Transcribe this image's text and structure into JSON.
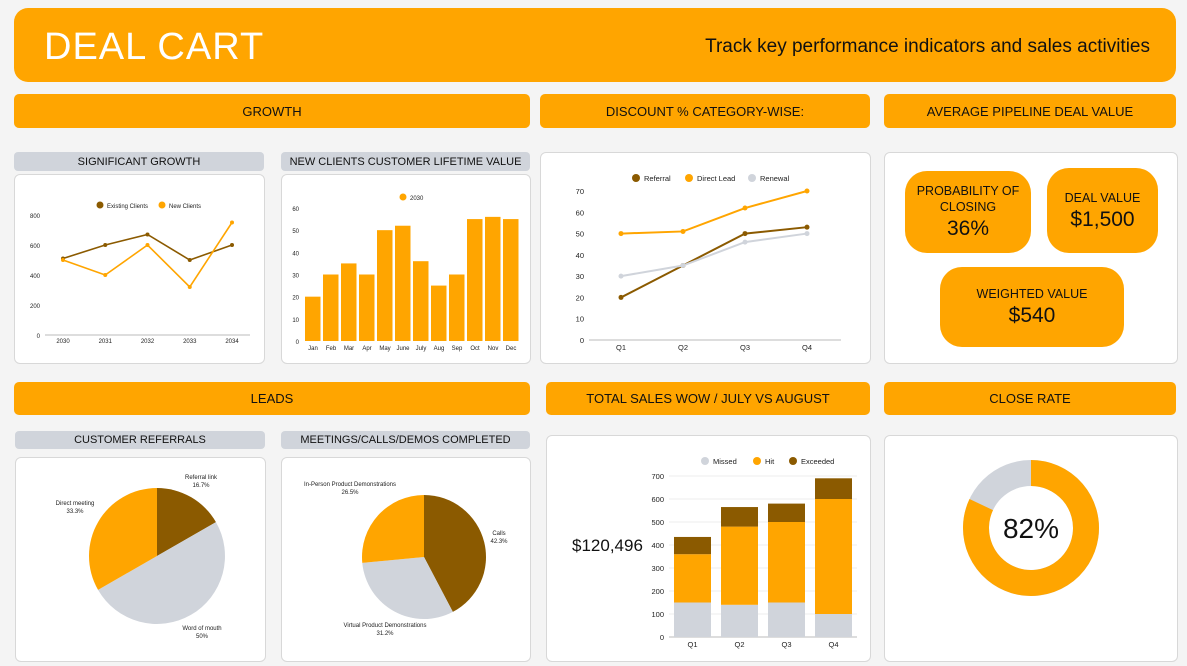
{
  "header": {
    "title": "DEAL CART",
    "subtitle": "Track key performance indicators and sales activities"
  },
  "sections": {
    "growth": "GROWTH",
    "discount": "DISCOUNT % CATEGORY-WISE:",
    "pipeline": "AVERAGE PIPELINE DEAL VALUE",
    "leads": "LEADS",
    "total_sales": "TOTAL SALES WOW / JULY VS AUGUST",
    "close_rate": "CLOSE RATE"
  },
  "subsections": {
    "sig_growth": "SIGNIFICANT GROWTH",
    "new_clients": "NEW CLIENTS CUSTOMER LIFETIME VALUE",
    "referrals": "CUSTOMER REFERRALS",
    "meetings": "MEETINGS/CALLS/DEMOS COMPLETED"
  },
  "colors": {
    "orange": "#ffa500",
    "brown": "#8b5a00",
    "gray": "#d0d4db"
  },
  "kpi": {
    "prob_label": "PROBABILITY OF CLOSING",
    "prob_value": "36%",
    "deal_label": "DEAL VALUE",
    "deal_value": "$1,500",
    "weighted_label": "WEIGHTED VALUE",
    "weighted_value": "$540"
  },
  "sales_total": "$120,496",
  "close_rate": {
    "value": 0.82,
    "label": "82%"
  },
  "chart_data": [
    {
      "id": "sig_growth",
      "type": "line",
      "categories": [
        "2030",
        "2031",
        "2032",
        "2033",
        "2034"
      ],
      "series": [
        {
          "name": "Existing Clients",
          "values": [
            510,
            600,
            670,
            500,
            600
          ]
        },
        {
          "name": "New Clients",
          "values": [
            500,
            400,
            600,
            320,
            750
          ]
        }
      ],
      "yticks": [
        0,
        200,
        400,
        600,
        800
      ],
      "ylim": [
        0,
        800
      ],
      "legend": "top"
    },
    {
      "id": "new_clients",
      "type": "bar",
      "categories": [
        "Jan",
        "Feb",
        "Mar",
        "Apr",
        "May",
        "June",
        "July",
        "Aug",
        "Sep",
        "Oct",
        "Nov",
        "Dec"
      ],
      "series": [
        {
          "name": "2030",
          "values": [
            20,
            30,
            35,
            30,
            50,
            52,
            36,
            25,
            30,
            55,
            56,
            55
          ]
        }
      ],
      "yticks": [
        0,
        10,
        20,
        30,
        40,
        50,
        60
      ],
      "ylim": [
        0,
        60
      ],
      "legend": "top"
    },
    {
      "id": "discount",
      "type": "line",
      "categories": [
        "Q1",
        "Q2",
        "Q3",
        "Q4"
      ],
      "series": [
        {
          "name": "Referral",
          "values": [
            20,
            35,
            50,
            53
          ]
        },
        {
          "name": "Direct Lead",
          "values": [
            50,
            51,
            62,
            70
          ]
        },
        {
          "name": "Renewal",
          "values": [
            30,
            35,
            46,
            50
          ]
        }
      ],
      "yticks": [
        0,
        10,
        20,
        30,
        40,
        50,
        60,
        70
      ],
      "ylim": [
        0,
        70
      ],
      "legend": "top"
    },
    {
      "id": "referrals",
      "type": "pie",
      "slices": [
        {
          "label": "Referral link",
          "pct": "16.7%",
          "value": 16.7
        },
        {
          "label": "Word of mouth",
          "pct": "50%",
          "value": 50
        },
        {
          "label": "Direct meeting",
          "pct": "33.3%",
          "value": 33.3
        }
      ]
    },
    {
      "id": "meetings",
      "type": "pie",
      "slices": [
        {
          "label": "Calls",
          "pct": "42.3%",
          "value": 42.3
        },
        {
          "label": "Virtual Product Demonstrations",
          "pct": "31.2%",
          "value": 31.2
        },
        {
          "label": "In-Person Product Demonstrations",
          "pct": "26.5%",
          "value": 26.5
        }
      ]
    },
    {
      "id": "total_sales",
      "type": "bar",
      "stacked": true,
      "categories": [
        "Q1",
        "Q2",
        "Q3",
        "Q4"
      ],
      "series": [
        {
          "name": "Missed",
          "values": [
            150,
            140,
            150,
            100
          ]
        },
        {
          "name": "Hit",
          "values": [
            210,
            340,
            350,
            500
          ]
        },
        {
          "name": "Exceeded",
          "values": [
            75,
            85,
            80,
            90
          ]
        }
      ],
      "yticks": [
        0,
        100,
        200,
        300,
        400,
        500,
        600,
        700
      ],
      "ylim": [
        0,
        700
      ],
      "legend": "top"
    }
  ]
}
